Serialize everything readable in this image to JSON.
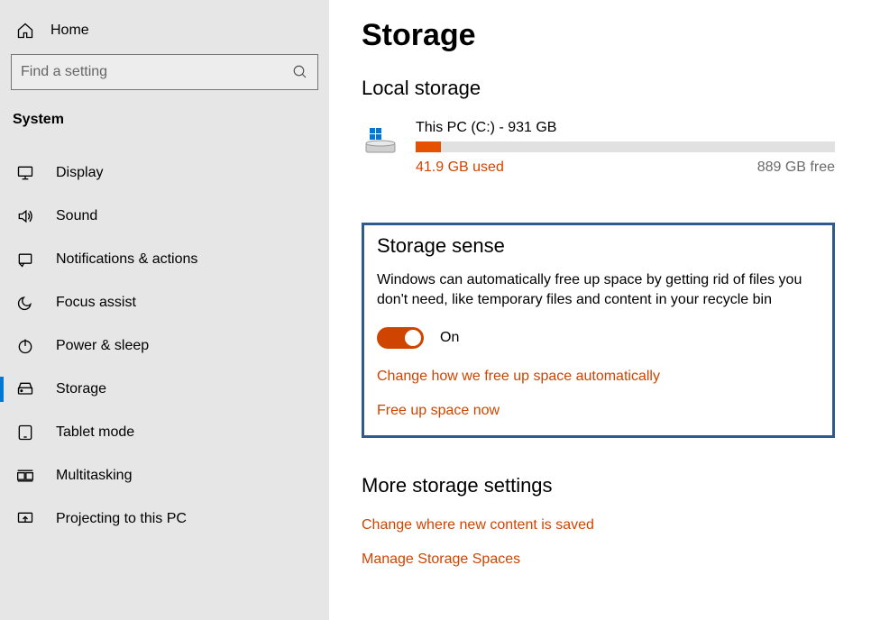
{
  "sidebar": {
    "home_label": "Home",
    "search_placeholder": "Find a setting",
    "category_label": "System",
    "items": [
      {
        "label": "Display",
        "icon": "monitor"
      },
      {
        "label": "Sound",
        "icon": "speaker"
      },
      {
        "label": "Notifications & actions",
        "icon": "notification"
      },
      {
        "label": "Focus assist",
        "icon": "moon"
      },
      {
        "label": "Power & sleep",
        "icon": "power"
      },
      {
        "label": "Storage",
        "icon": "drive",
        "active": true
      },
      {
        "label": "Tablet mode",
        "icon": "tablet"
      },
      {
        "label": "Multitasking",
        "icon": "multitask"
      },
      {
        "label": "Projecting to this PC",
        "icon": "project"
      }
    ]
  },
  "main": {
    "page_title": "Storage",
    "local_storage": {
      "title": "Local storage",
      "drive_name": "This PC (C:) - 931 GB",
      "used_label": "41.9 GB used",
      "free_label": "889 GB free"
    },
    "storage_sense": {
      "title": "Storage sense",
      "description": "Windows can automatically free up space by getting rid of files you don't need, like temporary files and content in your recycle bin",
      "toggle_label": "On",
      "links": [
        "Change how we free up space automatically",
        "Free up space now"
      ]
    },
    "more_settings": {
      "title": "More storage settings",
      "links": [
        "Change where new content is saved",
        "Manage Storage Spaces"
      ]
    }
  }
}
